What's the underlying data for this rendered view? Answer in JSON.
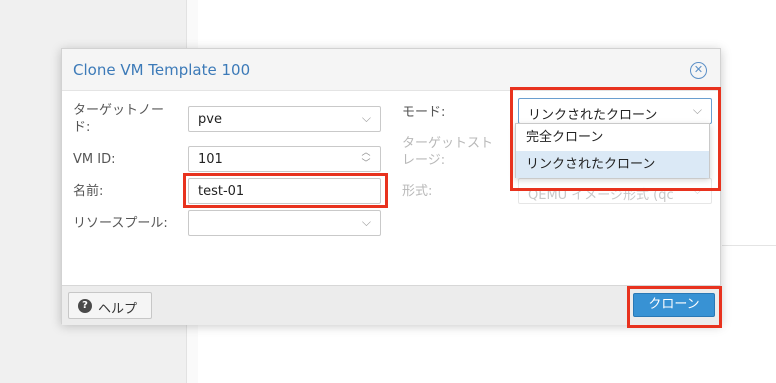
{
  "dialog": {
    "title": "Clone VM Template 100",
    "close_icon": "close-circle-icon"
  },
  "form": {
    "target_node": {
      "label": "ターゲットノー\nド:",
      "value": "pve"
    },
    "vm_id": {
      "label": "VM ID:",
      "value": "101"
    },
    "name": {
      "label": "名前:",
      "value": "test-01"
    },
    "resource_pool": {
      "label": "リソースプール:",
      "value": ""
    },
    "mode": {
      "label": "モード:",
      "value": "リンクされたクローン"
    },
    "target_storage": {
      "label": "ターゲットスト\nレージ:"
    },
    "format": {
      "label": "形式:",
      "value": "QEMU イメージ形式 (qc"
    }
  },
  "mode_dropdown": {
    "options": [
      "完全クローン",
      "リンクされたクローン"
    ],
    "selected_index": 1
  },
  "footer": {
    "help_label": "ヘルプ",
    "clone_label": "クローン"
  },
  "colors": {
    "accent": "#3892d4",
    "title": "#3c7ab8",
    "highlight": "#e8321e"
  }
}
